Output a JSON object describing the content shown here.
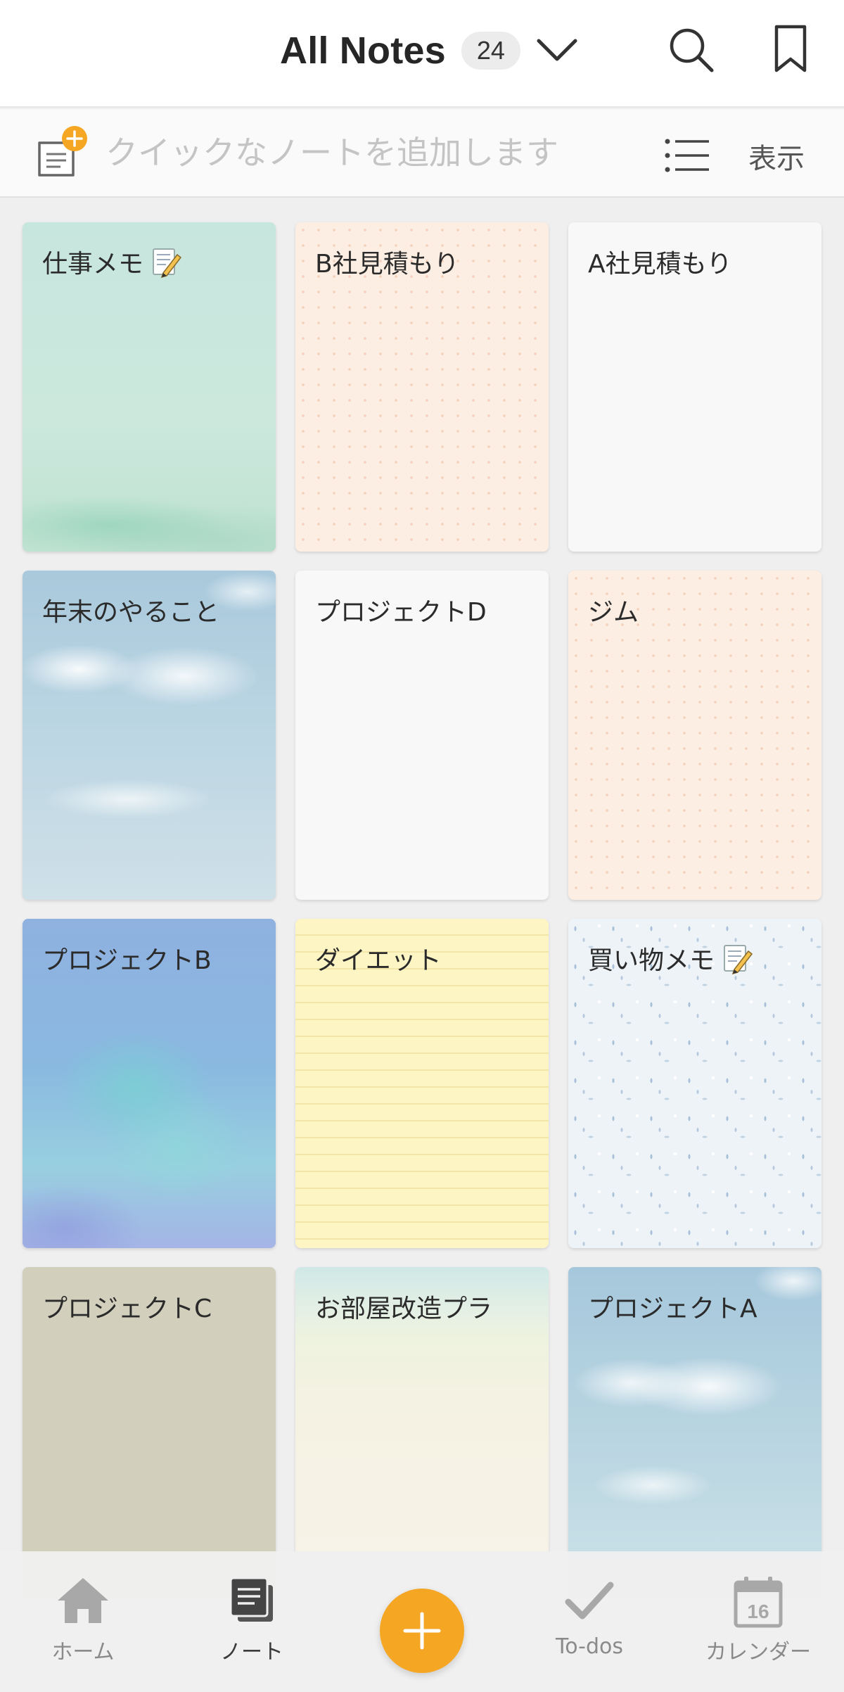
{
  "header": {
    "title": "All Notes",
    "count": "24",
    "dropdown_icon": "chevron-down-icon",
    "search_icon": "search-icon",
    "bookmark_icon": "bookmark-icon"
  },
  "quick_note": {
    "placeholder": "クイックなノートを追加します",
    "value": "",
    "view_label": "表示",
    "add_icon": "add-note-icon",
    "list_icon": "list-view-icon"
  },
  "notes": [
    {
      "title": "仕事メモ",
      "emoji": "memo-pencil-icon",
      "background": "mint-watercolor"
    },
    {
      "title": "B社見積もり",
      "background": "peach-dots"
    },
    {
      "title": "A社見積もり",
      "background": "plain-white"
    },
    {
      "title": "年末のやること",
      "background": "sky-clouds"
    },
    {
      "title": "プロジェクトD",
      "background": "plain-white"
    },
    {
      "title": "ジム",
      "background": "peach-dots"
    },
    {
      "title": "プロジェクトB",
      "background": "blue-watercolor"
    },
    {
      "title": "ダイエット",
      "background": "yellow-lined"
    },
    {
      "title": "買い物メモ",
      "emoji": "memo-pencil-icon",
      "background": "blue-confetti"
    },
    {
      "title": "プロジェクトC",
      "background": "khaki"
    },
    {
      "title": "お部屋改造プラ",
      "background": "beach"
    },
    {
      "title": "プロジェクトA",
      "background": "sky-clouds"
    }
  ],
  "bottom_nav": {
    "items": [
      {
        "label": "ホーム",
        "icon": "home-icon"
      },
      {
        "label": "ノート",
        "icon": "notes-icon",
        "active": true
      },
      {
        "label": "To-dos",
        "icon": "check-icon"
      },
      {
        "label": "カレンダー",
        "icon": "calendar-icon",
        "calendar_day": "16"
      }
    ],
    "fab_icon": "plus-icon"
  },
  "colors": {
    "accent": "#f5a623",
    "header_bg": "#ffffff",
    "page_bg": "#efefef",
    "nav_inactive": "#8a8a8a",
    "nav_active": "#3a3a3a"
  }
}
